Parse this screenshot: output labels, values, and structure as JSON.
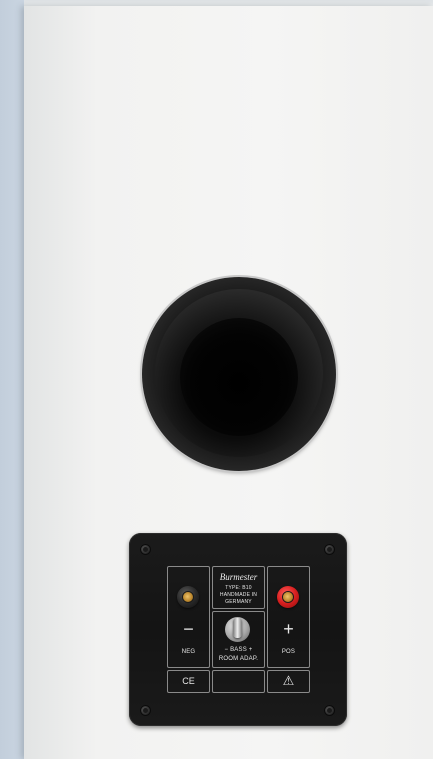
{
  "plate": {
    "brand": "Burmester",
    "type_line": "TYPE: B10",
    "origin_line1": "HANDMADE IN",
    "origin_line2": "GERMANY",
    "neg_sign": "−",
    "pos_sign": "+",
    "neg_label": "NEG",
    "pos_label": "POS",
    "bass_label": "−  BASS  +",
    "room_label": "ROOM ADAP.",
    "ce_mark": "CE",
    "warning_symbol": "⚠"
  },
  "colors": {
    "cabinet": "#f3f3f2",
    "plate": "#161616",
    "positive_terminal": "#d81f1f",
    "negative_terminal": "#2a2a2a"
  },
  "icons": {
    "switch": "toggle-switch-icon",
    "warning": "warning-triangle-icon",
    "ce": "ce-mark-icon"
  }
}
